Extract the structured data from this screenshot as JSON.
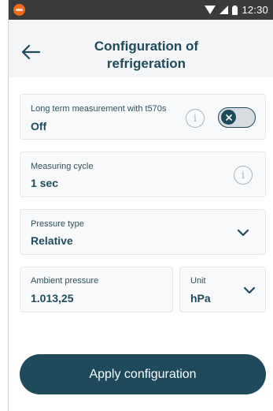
{
  "status_bar": {
    "time": "12:30"
  },
  "header": {
    "title_line1": "Configuration of",
    "title_line2": "refrigeration"
  },
  "long_term": {
    "label": "Long term measurement with t570s",
    "value": "Off",
    "toggle_on": false
  },
  "measuring_cycle": {
    "label": "Measuring cycle",
    "value": "1 sec"
  },
  "pressure_type": {
    "label": "Pressure type",
    "value": "Relative"
  },
  "ambient_pressure": {
    "label": "Ambient pressure",
    "value": "1.013,25"
  },
  "unit": {
    "label": "Unit",
    "value": "hPa"
  },
  "apply_button": {
    "label": "Apply configuration"
  },
  "colors": {
    "primary": "#1e4a5c",
    "status_bar": "#3b3b3b",
    "brand_logo": "#f26a1b",
    "card_bg": "#f8f9fa"
  },
  "icons": {
    "back": "arrow-left-icon",
    "info": "info-icon",
    "toggle_knob": "close-icon",
    "dropdown": "chevron-down-icon"
  }
}
